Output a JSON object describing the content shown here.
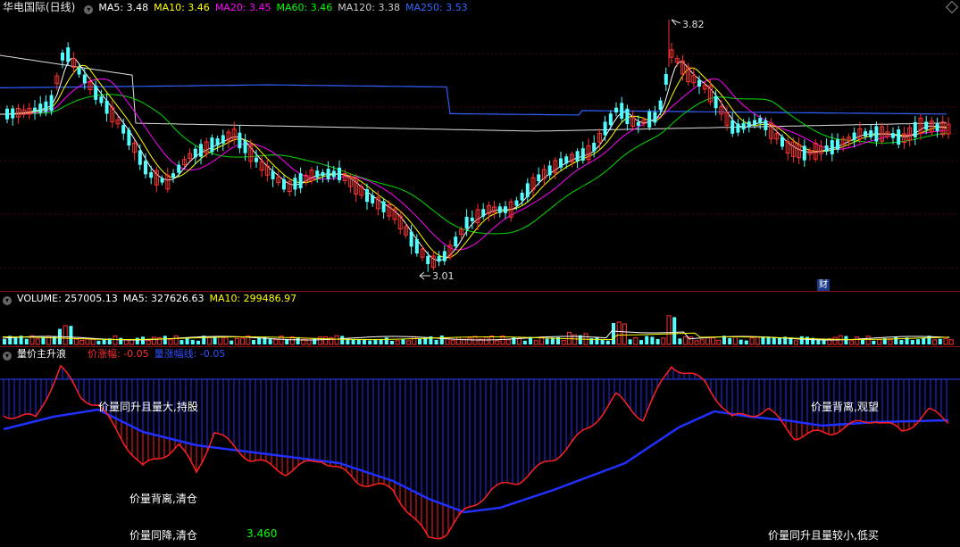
{
  "main": {
    "title": "华电国际(日线)",
    "ma": [
      {
        "label": "MA5: 3.48",
        "color": "#ffffff"
      },
      {
        "label": "MA10: 3.46",
        "color": "#ffff00"
      },
      {
        "label": "MA20: 3.45",
        "color": "#ff00ff"
      },
      {
        "label": "MA60: 3.46",
        "color": "#00ff00"
      },
      {
        "label": "MA120: 3.38",
        "color": "#cccccc"
      },
      {
        "label": "MA250: 3.53",
        "color": "#3366ff"
      }
    ],
    "high_label": "3.82",
    "low_label": "3.01",
    "cai_badge": "财"
  },
  "volume": {
    "title": "VOLUME: 257005.13",
    "ma5": "MA5: 327626.63",
    "ma10": "MA10: 299486.97"
  },
  "indicator": {
    "title": "量价主升浪",
    "line1": "价涨幅: -0.05",
    "line2": "量涨幅线: -0.05",
    "notes": [
      {
        "text": "价量同升且量大,持股"
      },
      {
        "text": "价量背离,观望"
      },
      {
        "text": "价量背离,清仓"
      },
      {
        "text": "价量同降,清仓"
      },
      {
        "text": "价量同升且量较小,低买"
      }
    ],
    "value": "3.460"
  },
  "colors": {
    "up": "#ff3030",
    "down": "#54ffff",
    "bg": "#000000",
    "grid": "#8b1010"
  }
}
